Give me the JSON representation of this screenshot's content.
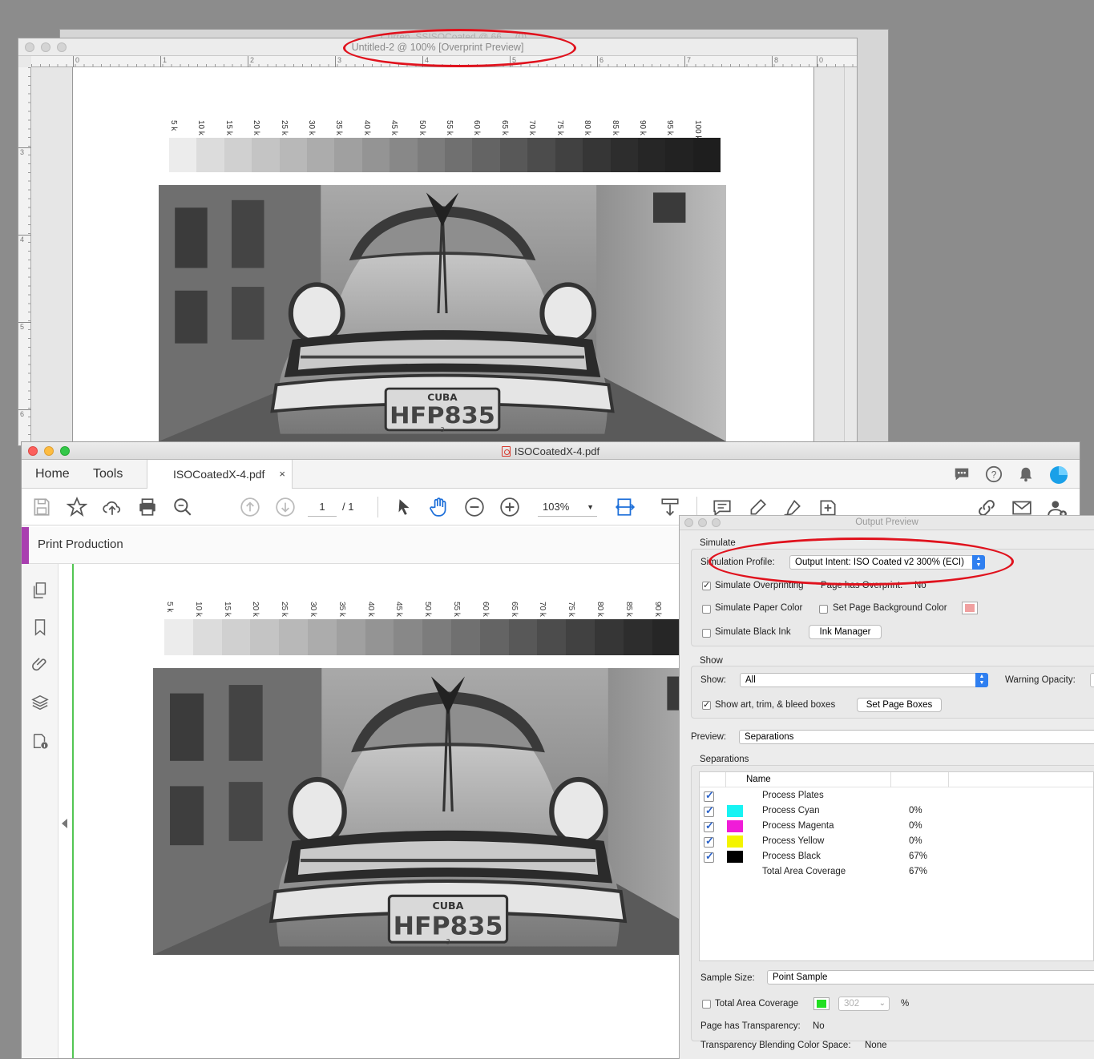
{
  "back_window": {
    "behind_title": "Curren_SSISOCoated @ 66 ... (0)",
    "title": "Untitled-2 @ 100% [Overprint Preview]",
    "ruler_h": [
      "0",
      "1",
      "2",
      "3",
      "4",
      "5",
      "6",
      "7",
      "8",
      "0"
    ],
    "ruler_v": [
      "3",
      "4",
      "5",
      "6"
    ]
  },
  "gray_strip": {
    "labels": [
      "5 k",
      "10 k",
      "15 k",
      "20 k",
      "25 k",
      "30 k",
      "35 k",
      "40 k",
      "45 k",
      "50 k",
      "55 k",
      "60 k",
      "65 k",
      "70 k",
      "75 k",
      "80 k",
      "85 k",
      "90 k",
      "95 k",
      "100 k"
    ],
    "colors": [
      "#ececec",
      "#dcdcdc",
      "#d0d0d0",
      "#c4c4c4",
      "#b8b8b8",
      "#acacac",
      "#a0a0a0",
      "#949494",
      "#888888",
      "#7c7c7c",
      "#707070",
      "#646464",
      "#585858",
      "#4c4c4c",
      "#414141",
      "#363636",
      "#2d2d2d",
      "#262626",
      "#222222",
      "#1e1e1e"
    ]
  },
  "photo": {
    "plate_top": "CUBA",
    "plate_main": "HFP835",
    "plate_bottom": "3"
  },
  "front_window": {
    "title": "ISOCoatedX-4.pdf",
    "tabs": {
      "home": "Home",
      "tools": "Tools",
      "doc": "ISOCoatedX-4.pdf",
      "close": "×"
    },
    "page_current": "1",
    "page_total": "/ 1",
    "zoom": "103%",
    "panel_label": "Print Production"
  },
  "output_preview": {
    "title": "Output Preview",
    "simulate_heading": "Simulate",
    "simulation_profile_label": "Simulation Profile:",
    "simulation_profile_value": "Output Intent: ISO Coated v2 300% (ECI)",
    "simulate_overprinting": "Simulate Overprinting",
    "page_has_overprint_label": "Page has Overprint:",
    "page_has_overprint_value": "No",
    "simulate_paper_color": "Simulate Paper Color",
    "set_page_bg_color": "Set Page Background Color",
    "simulate_black_ink": "Simulate Black Ink",
    "ink_manager": "Ink Manager",
    "show_heading": "Show",
    "show_label": "Show:",
    "show_value": "All",
    "warning_opacity_label": "Warning Opacity:",
    "show_boxes": "Show art, trim, & bleed boxes",
    "set_page_boxes": "Set Page Boxes",
    "preview_label": "Preview:",
    "preview_value": "Separations",
    "separations_heading": "Separations",
    "col_name": "Name",
    "rows": [
      {
        "name": "Process Plates",
        "value": ""
      },
      {
        "name": "Process Cyan",
        "value": "0%"
      },
      {
        "name": "Process Magenta",
        "value": "0%"
      },
      {
        "name": "Process Yellow",
        "value": "0%"
      },
      {
        "name": "Process Black",
        "value": "67%"
      },
      {
        "name": "Total Area Coverage",
        "value": "67%"
      }
    ],
    "sample_size_label": "Sample Size:",
    "sample_size_value": "Point Sample",
    "total_area_coverage": "Total Area Coverage",
    "tac_value": "302",
    "tac_unit": "%",
    "page_has_transparency_label": "Page has Transparency:",
    "page_has_transparency_value": "No",
    "blending_label": "Transparency Blending Color Space:",
    "blending_value": "None"
  },
  "colors": {
    "cyan": "#17f3f3",
    "magenta": "#f01cd8",
    "yellow": "#f4f400",
    "black": "#000000",
    "accent": "#a93fb0",
    "annotation": "#e0121d"
  }
}
